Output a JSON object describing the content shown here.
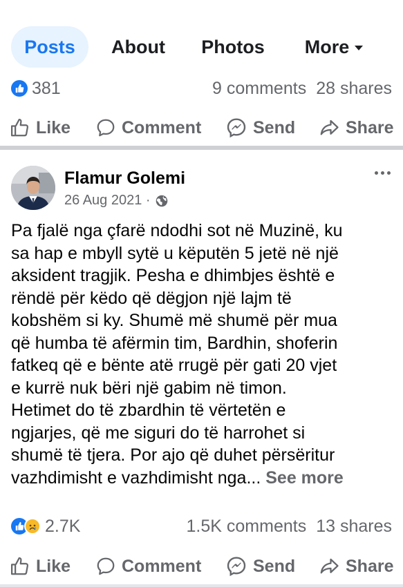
{
  "tabs": [
    {
      "label": "Posts"
    },
    {
      "label": "About"
    },
    {
      "label": "Photos"
    },
    {
      "label": "More"
    }
  ],
  "post1": {
    "reactions": "381",
    "comments": "9 comments",
    "shares": "28 shares"
  },
  "actions": {
    "like": "Like",
    "comment": "Comment",
    "send": "Send",
    "share": "Share"
  },
  "post2": {
    "author": "Flamur Golemi",
    "date": "26 Aug 2021 ·",
    "text": "Pa fjalë nga çfarë ndodhi sot në Muzinë, ku\nsa hap e mbyll sytë u këputën 5 jetë në një\naksident tragjik. Pesha e dhimbjes është e\nrëndë për këdo që dëgjon një lajm të\nkobshëm si ky. Shumë më shumë për mua\nqë humba të afërmin tim, Bardhin, shoferin\nfatkeq që e bënte atë rrugë për gati 20 vjet\ne kurrë nuk bëri një gabim në timon.\nHetimet do të zbardhin të vërtetën e\nngjarjes, që me siguri do të harrohet si\nshumë të tjera. Por ajo që duhet përsëritur\nvazhdimisht e vazhdimisht nga... ",
    "see_more": "See more",
    "reactions": "2.7K",
    "comments": "1.5K comments",
    "shares": "13 shares"
  },
  "colors": {
    "accent": "#1877f2",
    "tab_active_bg": "#e7f3ff",
    "secondary_text": "#65676b",
    "divider": "#ced0d4",
    "sad_reaction": "#f7b928"
  },
  "icons": [
    "like-reaction-icon",
    "sad-reaction-icon",
    "thumbs-up-icon",
    "comment-icon",
    "messenger-icon",
    "share-icon",
    "globe-icon",
    "more-options-icon",
    "dropdown-caret-icon"
  ]
}
